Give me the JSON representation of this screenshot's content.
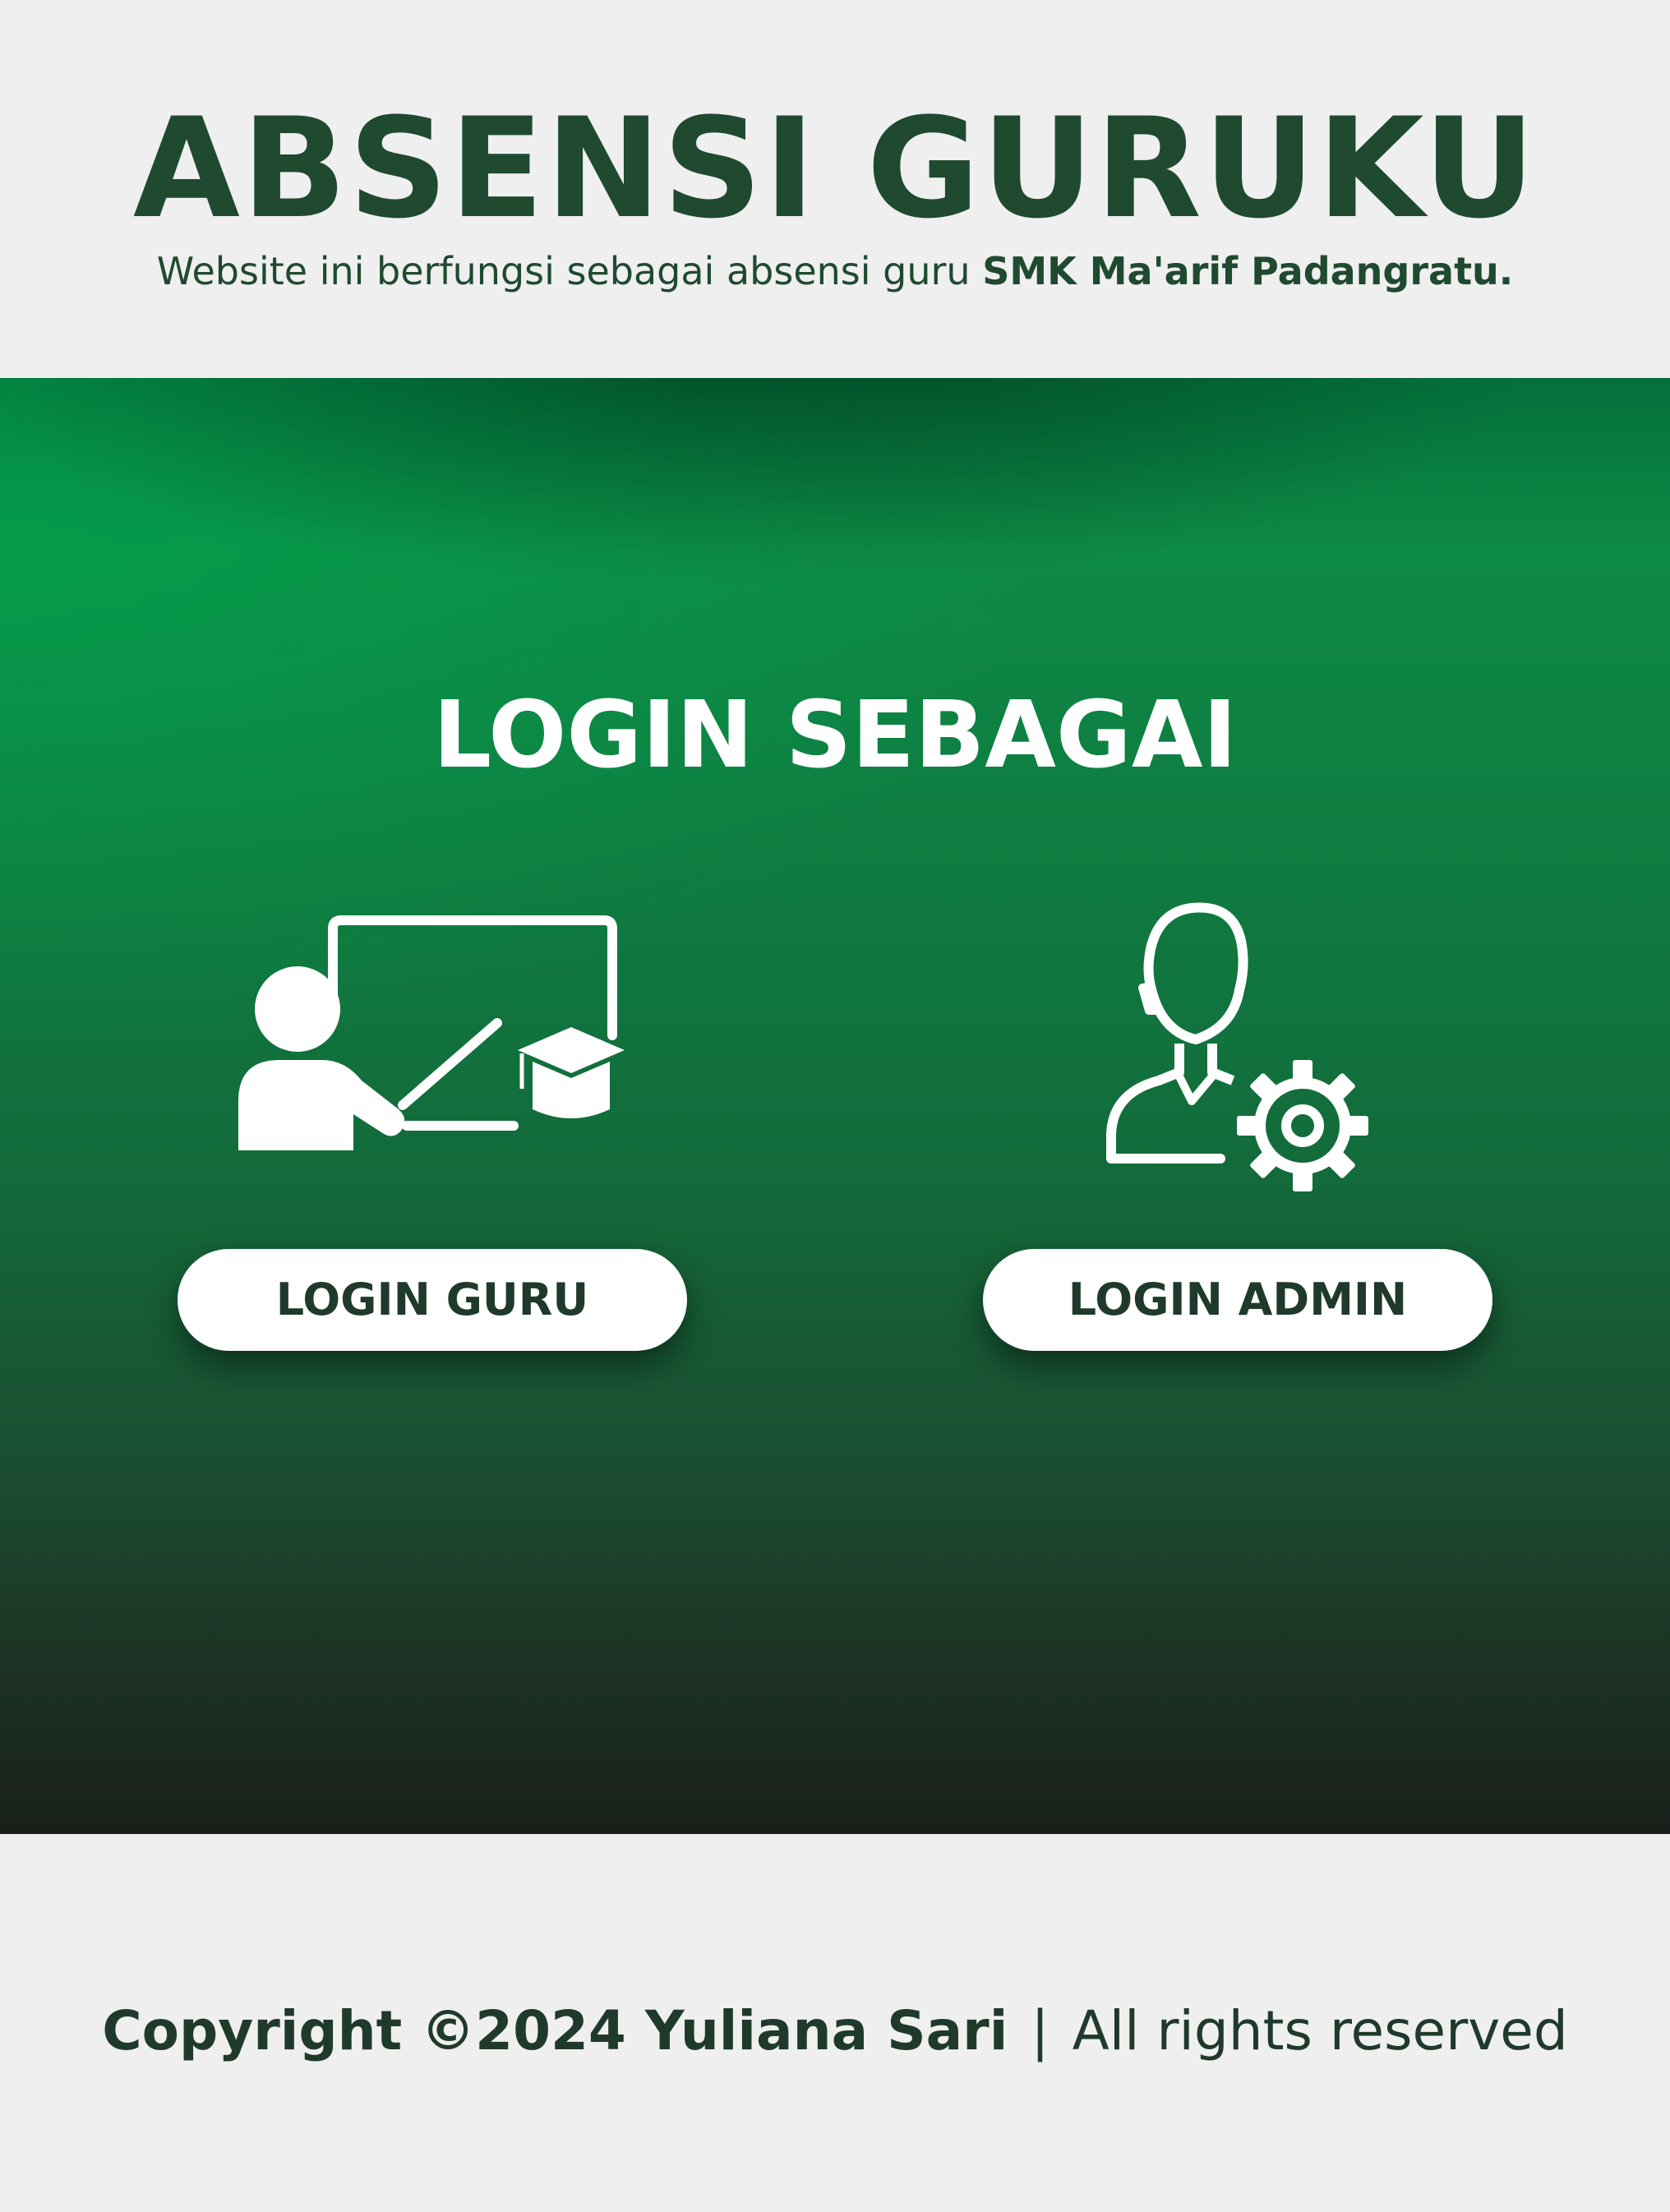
{
  "header": {
    "title": "ABSENSI GURUKU",
    "subtitle_prefix": "Website ini berfungsi sebagai absensi guru ",
    "subtitle_school": "SMK Ma'arif Padangratu."
  },
  "hero": {
    "title": "LOGIN SEBAGAI",
    "teacher_icon": "teacher-board-icon",
    "admin_icon": "admin-gear-icon",
    "login_guru_label": "LOGIN GURU",
    "login_admin_label": "LOGIN ADMIN"
  },
  "footer": {
    "copyright": "Copyright ©2024 Yuliana Sari",
    "separator": "|",
    "rights": "All rights reserved"
  },
  "colors": {
    "brand_dark_green": "#1f4a30",
    "hero_green": "#0f7a40",
    "background": "#efefef",
    "button_bg": "#ffffff"
  }
}
